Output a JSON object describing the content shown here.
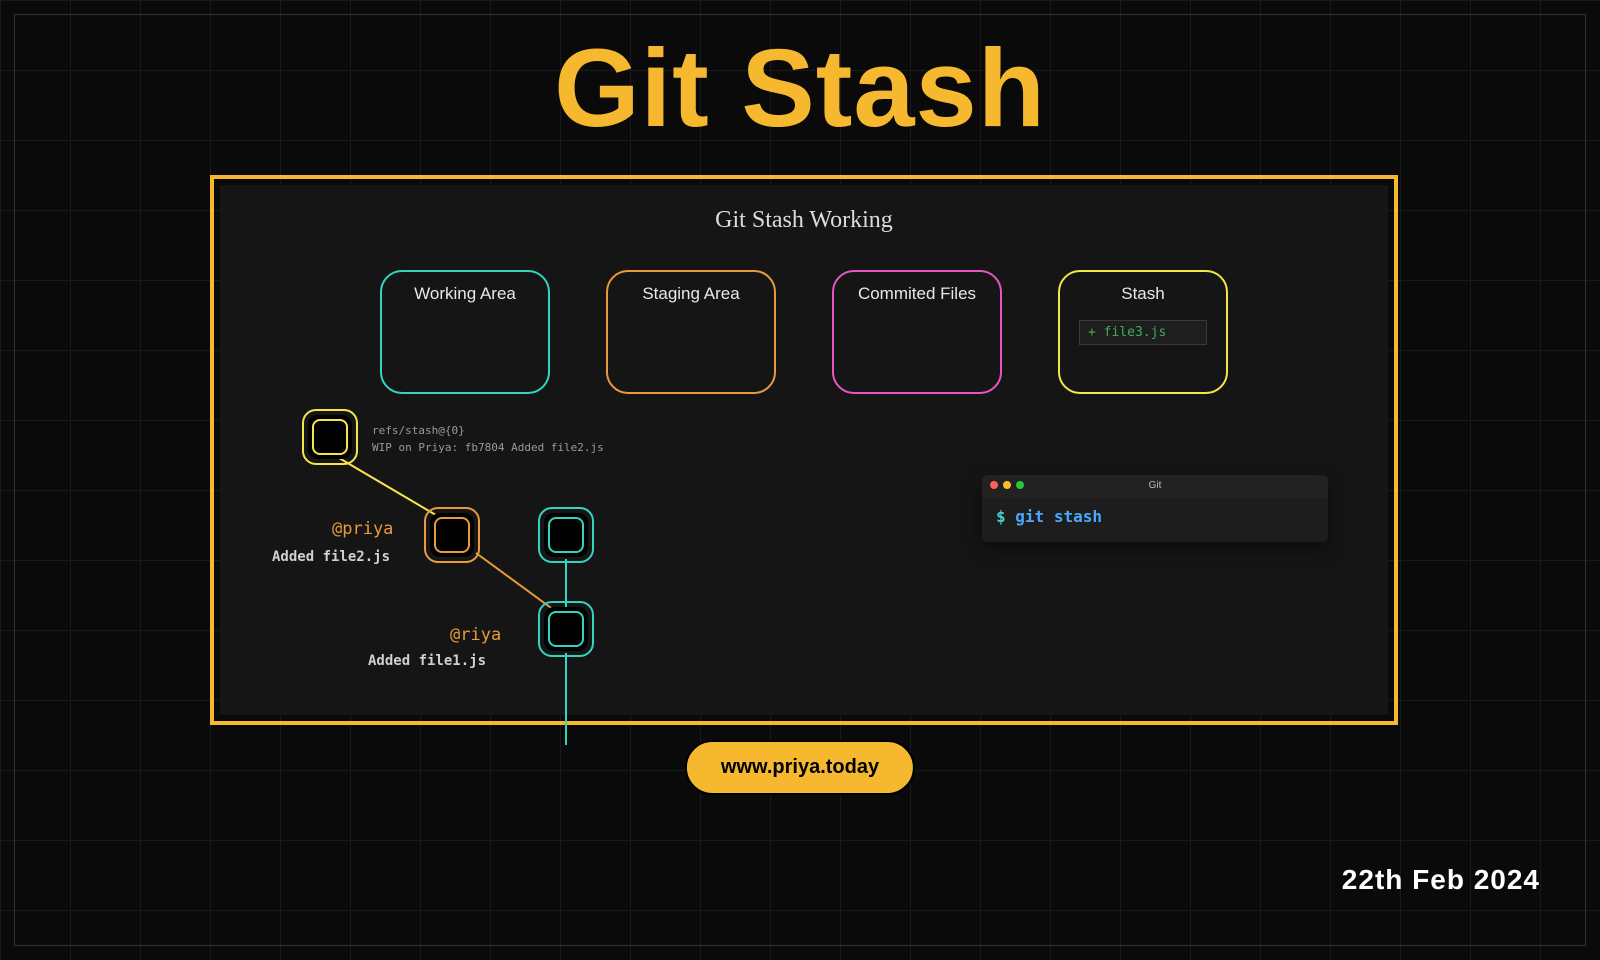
{
  "title": "Git Stash",
  "diagram": {
    "heading": "Git Stash Working",
    "areas": {
      "working": "Working Area",
      "staging": "Staging Area",
      "commited": "Commited Files",
      "stash": "Stash",
      "stash_file": "file3.js"
    }
  },
  "graph": {
    "ref_line1": "refs/stash@{0}",
    "ref_line2": "WIP on Priya: fb7804 Added file2.js",
    "label_priya": "@priya",
    "sub_priya": "Added file2.js",
    "label_riya": "@riya",
    "sub_riya": "Added file1.js"
  },
  "terminal": {
    "title": "Git",
    "prompt": "$",
    "command": "git stash"
  },
  "footer": {
    "site": "www.priya.today",
    "date": "22th Feb 2024"
  }
}
